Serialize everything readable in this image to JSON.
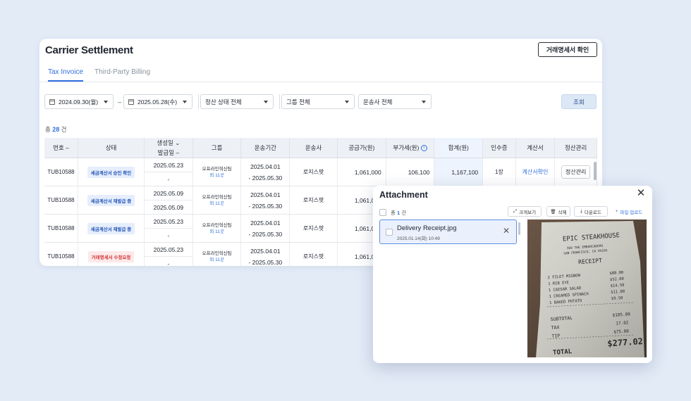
{
  "page": {
    "title": "Carrier Settlement",
    "confirm_button": "거래명세서 확인"
  },
  "tabs": [
    {
      "label": "Tax Invoice",
      "active": true
    },
    {
      "label": "Third-Party Billing",
      "active": false
    }
  ],
  "filters": {
    "date_from": "2024.09.30(월)",
    "date_to": "2025.05.28(수)",
    "status": "정산 상태 전체",
    "group": "그룹 전체",
    "carrier": "운송사 전체",
    "search_button": "조회"
  },
  "summary": {
    "prefix": "총",
    "count": "28",
    "suffix": "건"
  },
  "table": {
    "headers": {
      "number": "번호",
      "status": "상태",
      "created": "생성일",
      "issued": "발급일",
      "group": "그룹",
      "period": "운송기간",
      "carrier": "운송사",
      "supply": "공급가(원)",
      "vat": "부가세(원)",
      "total": "합계(원)",
      "stamp": "인수증",
      "invoice": "계산서",
      "manage": "정산관리"
    },
    "rows": [
      {
        "number": "TUB10588",
        "status": "세금계산서 승인 확인",
        "status_color": "blue",
        "created": "2025.05.23",
        "issued": "-",
        "group_name": "오프라인혁신팀",
        "group_more": "외 11곳",
        "period_start": "2025.04.01",
        "period_end": "- 2025.05.30",
        "carrier": "로지스팟",
        "supply": "1,061,000",
        "vat": "106,100",
        "total": "1,167,100",
        "stamp": "1장",
        "invoice": "계산서확인",
        "manage": "정산관리"
      },
      {
        "number": "TUB10588",
        "status": "세금계산서 재발급 중",
        "status_color": "blue",
        "created": "2025.05.09",
        "issued": "2025.05.09",
        "group_name": "오프라인혁신팀",
        "group_more": "외 11곳",
        "period_start": "2025.04.01",
        "period_end": "- 2025.05.30",
        "carrier": "로지스팟",
        "supply": "1,061,000"
      },
      {
        "number": "TUB10588",
        "status": "세금계산서 재발급 중",
        "status_color": "blue",
        "created": "2025.05.23",
        "issued": "-",
        "group_name": "오프라인혁신팀",
        "group_more": "외 11곳",
        "period_start": "2025.04.01",
        "period_end": "- 2025.05.30",
        "carrier": "로지스팟",
        "supply": "1,061,000"
      },
      {
        "number": "TUB10588",
        "status": "거래명세서 수정요청",
        "status_color": "red",
        "created": "2025.05.23",
        "issued": "-",
        "group_name": "오프라인혁신팀",
        "group_more": "외 11곳",
        "period_start": "2025.04.01",
        "period_end": "- 2025.05.30",
        "carrier": "로지스팟",
        "supply": "1,061,000"
      }
    ]
  },
  "attachment": {
    "title": "Attachment",
    "count_prefix": "총",
    "count": "1",
    "count_suffix": "건",
    "tools": {
      "preview": "크게보기",
      "delete": "삭제",
      "download": "다운로드",
      "upload": "파일 업로드"
    },
    "file": {
      "name": "Delivery Receipt.jpg",
      "date": "2025.01.14(화) 10:49"
    },
    "receipt": {
      "restaurant": "EPIC STEAKHOUSE",
      "address1": "369 THE EMBARCADERO",
      "address2": "SAN FRANCISCO, CA 94105",
      "heading": "RECEIPT",
      "items": [
        {
          "name": "2 FILET MIGNON",
          "price": "$88.00"
        },
        {
          "name": "1 RIB EYE",
          "price": "$52.00"
        },
        {
          "name": "1 CAESAR SALAD",
          "price": "$14.50"
        },
        {
          "name": "1 CREAMED SPINACH",
          "price": "$11.00"
        },
        {
          "name": "1 BAKED POTATO",
          "price": "$9.50"
        }
      ],
      "subtotal_label": "SUBTOTAL",
      "subtotal": "$185.00",
      "tax_label": "TAX",
      "tax": "17.02",
      "tip_label": "TIP",
      "tip": "$75.00",
      "total_label": "TOTAL",
      "total": "$277.02"
    }
  }
}
